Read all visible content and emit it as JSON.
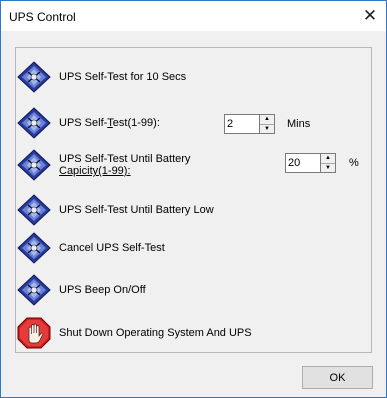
{
  "window": {
    "title": "UPS Control",
    "close_symbol": "✕"
  },
  "items": [
    {
      "label": "UPS Self-Test for 10 Secs",
      "icon": "ups-test-icon"
    },
    {
      "label_prefix": "UPS Self-",
      "label_underline": "T",
      "label_suffix": "est(1-99):",
      "icon": "ups-test-icon"
    },
    {
      "label_line1": "UPS Self-Test Until Battery",
      "label_line2": "Capicity(1-99):",
      "icon": "ups-test-icon"
    },
    {
      "label": "UPS Self-Test Until Battery Low",
      "icon": "ups-test-icon"
    },
    {
      "label": "Cancel UPS Self-Test",
      "icon": "ups-test-icon"
    },
    {
      "label": "UPS Beep On/Off",
      "icon": "ups-test-icon"
    },
    {
      "label": "Shut Down Operating System And UPS",
      "icon": "stop-hand-icon"
    }
  ],
  "test_minutes": {
    "value": "2",
    "unit": "Mins"
  },
  "battery_capacity": {
    "value": "20",
    "unit": "%"
  },
  "ok_label": "OK"
}
